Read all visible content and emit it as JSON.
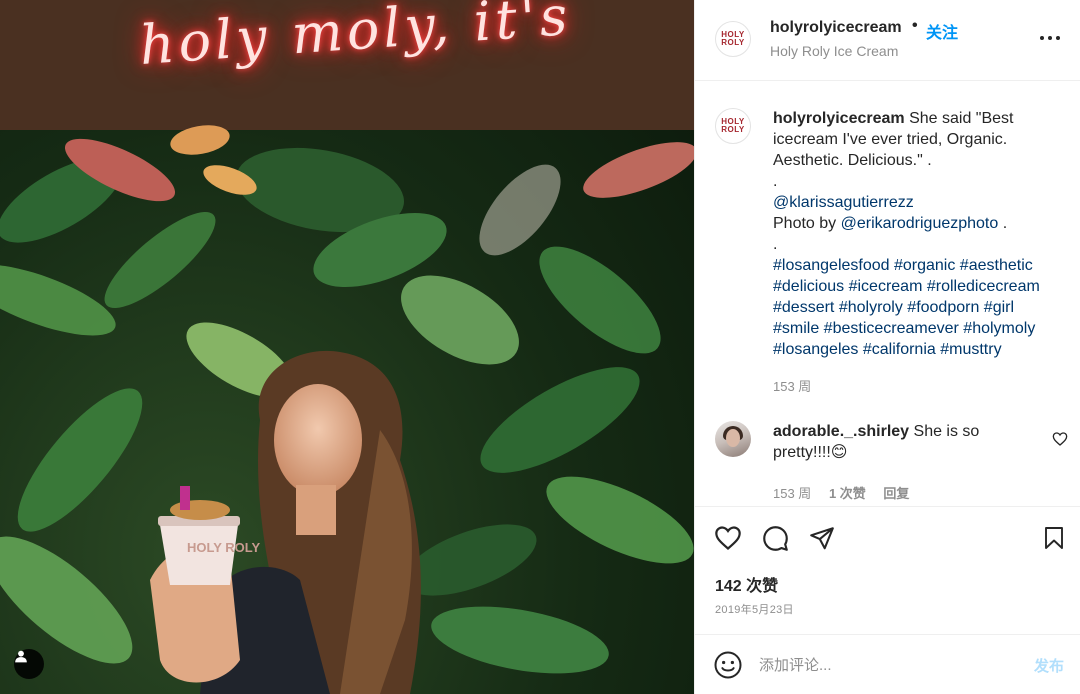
{
  "photo": {
    "neon_text": "holy moly, it's",
    "cup_logo": "HOLY ROLY"
  },
  "header": {
    "username": "holyrolyicecream",
    "separator": "•",
    "follow_label": "关注",
    "subtitle": "Holy Roly Ice Cream",
    "avatar_logo": "HOLY ROLY"
  },
  "caption": {
    "username": "holyrolyicecream",
    "lines": [
      "She said \"Best",
      "icecream I've ever tried, Organic.",
      "Aesthetic. Delicious.\" .",
      ".",
      "@klarissagutierrezz",
      "Photo by",
      "@erikarodriguezphoto",
      " .",
      ".",
      "#losangelesfood #organic #aesthetic",
      "#delicious #icecream #rolledicecream",
      "#dessert #holyroly #foodporn #girl",
      "#smile #besticecreamever #holymoly",
      "#losangeles #california #musttry"
    ],
    "time": "153 周"
  },
  "comment": {
    "username": "adorable._.shirley",
    "text": "She is so pretty!!!!😊",
    "time": "153 周",
    "likes": "1 次赞",
    "reply": "回复"
  },
  "actions": {
    "likes": "142 次赞",
    "date": "2019年5月23日"
  },
  "comment_box": {
    "placeholder": "添加评论...",
    "post_label": "发布"
  },
  "colors": {
    "accent": "#0095f6",
    "link": "#00376b",
    "muted": "#8e8e8e",
    "post_disabled": "#b2dffc"
  },
  "icons": {
    "like": "heart-icon",
    "comment": "speech-bubble-icon",
    "share": "paper-plane-icon",
    "save": "bookmark-icon",
    "more": "more-horizontal-icon",
    "emoji": "smile-icon",
    "user_tag": "user-icon"
  }
}
